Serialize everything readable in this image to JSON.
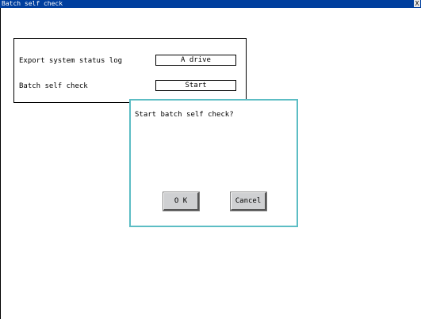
{
  "window": {
    "title": "Batch self check",
    "close_glyph": "X"
  },
  "panel": {
    "rows": [
      {
        "label": "Export system status log",
        "button": "A drive"
      },
      {
        "label": "Batch self check",
        "button": "Start"
      }
    ]
  },
  "dialog": {
    "message": "Start batch self check?",
    "ok_label": "O K",
    "cancel_label": "Cancel",
    "border_color": "#5cbdc4"
  },
  "colors": {
    "titlebar": "#003f9e",
    "button_face": "#cfd0d2"
  }
}
